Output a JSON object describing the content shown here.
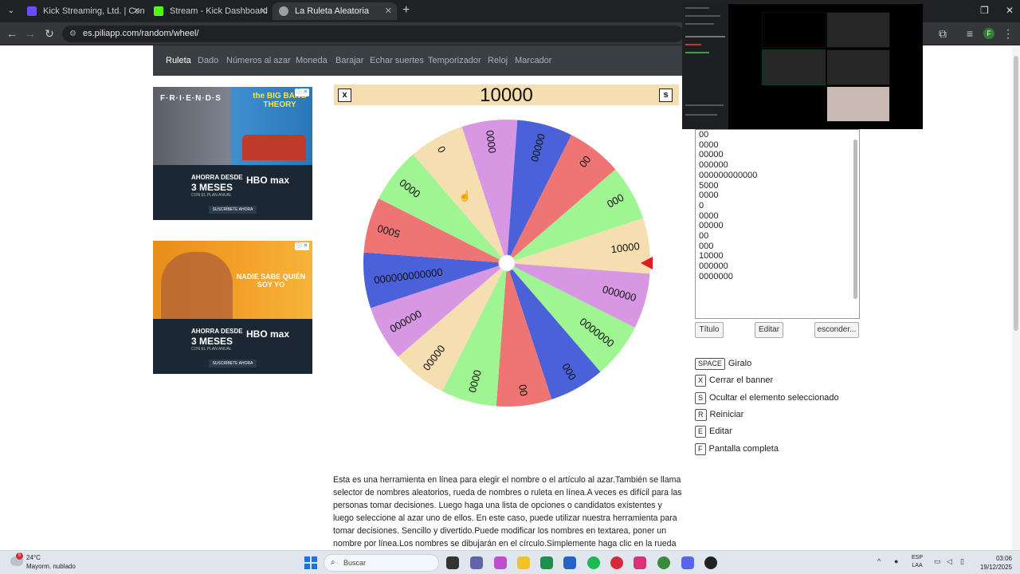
{
  "browser": {
    "tabs": [
      {
        "label": "Kick Streaming, Ltd. | Configura",
        "favicon_color": "#6a4cff",
        "active": false
      },
      {
        "label": "Stream - Kick Dashboard",
        "favicon_color": "#53fc18",
        "active": false
      },
      {
        "label": "La Ruleta Aleatoria",
        "favicon_color": "#9aa0a6",
        "active": true
      }
    ],
    "url": "es.piliapp.com/random/wheel/",
    "profile_initial": "F"
  },
  "nav": {
    "items": [
      "Ruleta",
      "Dado",
      "Números al azar",
      "Moneda",
      "Barajar",
      "Echar suertes",
      "Temporizador",
      "Reloj",
      "Marcador"
    ]
  },
  "ads": [
    {
      "show_title": "F·R·I·E·N·D·S",
      "show_title2": "the BIG BANG THEORY",
      "promo_line1": "AHORRA DESDE",
      "promo_line2": "3 MESES",
      "promo_line3": "CON EL PLAN ANUAL",
      "brand": "HBO max",
      "cta": "SUSCRÍBETE AHORA"
    },
    {
      "show_title": "NADIE SABE QUIÉN SOY YO",
      "promo_line1": "AHORRA DESDE",
      "promo_line2": "3 MESES",
      "promo_line3": "CON EL PLAN ANUAL",
      "brand": "HBO max",
      "cta": "SUSCRÍBETE AHORA"
    }
  ],
  "selection": {
    "close_key": "x",
    "value": "10000",
    "hide_key": "s"
  },
  "wheel": {
    "segments": [
      {
        "label": "10000",
        "color": "#f5dfb1"
      },
      {
        "label": "000000",
        "color": "#d797e3"
      },
      {
        "label": "0000000",
        "color": "#9ef592"
      },
      {
        "label": "000",
        "color": "#4a61da"
      },
      {
        "label": "00",
        "color": "#ef7575"
      },
      {
        "label": "0000",
        "color": "#9ef592"
      },
      {
        "label": "00000",
        "color": "#f5dfb1"
      },
      {
        "label": "000000",
        "color": "#d797e3"
      },
      {
        "label": "000000000000",
        "color": "#4a61da"
      },
      {
        "label": "5000",
        "color": "#ef7575"
      },
      {
        "label": "0000",
        "color": "#9ef592"
      },
      {
        "label": "0",
        "color": "#f5dfb1"
      },
      {
        "label": "0000",
        "color": "#d797e3"
      },
      {
        "label": "00000",
        "color": "#4a61da"
      },
      {
        "label": "00",
        "color": "#ef7575"
      },
      {
        "label": "000",
        "color": "#9ef592"
      }
    ],
    "pointer_color": "#e41b1b"
  },
  "editor": {
    "lines": [
      "00",
      "0000",
      "00000",
      "000000",
      "000000000000",
      "5000",
      "0000",
      "0",
      "0000",
      "00000",
      "00",
      "000",
      "10000",
      "000000",
      "0000000"
    ],
    "buttons": {
      "title": "Título",
      "edit": "Editar",
      "hide": "esconder..."
    }
  },
  "shortcuts": [
    {
      "key": "SPACE",
      "label": "Giralo"
    },
    {
      "key": "X",
      "label": "Cerrar el banner"
    },
    {
      "key": "S",
      "label": "Ocultar el elemento seleccionado"
    },
    {
      "key": "R",
      "label": "Reiniciar"
    },
    {
      "key": "E",
      "label": "Editar"
    },
    {
      "key": "F",
      "label": "Pantalla completa"
    }
  ],
  "description": "Esta es una herramienta en línea para elegir el nombre o el artículo al azar.También se llama selector de nombres aleatorios, rueda de nombres o ruleta en línea.A veces es difícil para las personas tomar decisiones. Luego haga una lista de opciones o candidatos existentes y luego seleccione al azar uno de ellos. En este caso, puede utilizar nuestra herramienta para tomar decisiones. Sencillo y divertido.Puede modificar los nombres en textarea, poner un nombre por línea.Los nombres se dibujarán en el círculo.Simplemente haga clic en la rueda",
  "taskbar": {
    "temperature": "24°C",
    "weather": "Mayorm. nublado",
    "notification_count": "5",
    "search_placeholder": "Buscar",
    "language": "ESP",
    "region": "LAA",
    "time": "03:06",
    "date": "19/12/2025"
  }
}
